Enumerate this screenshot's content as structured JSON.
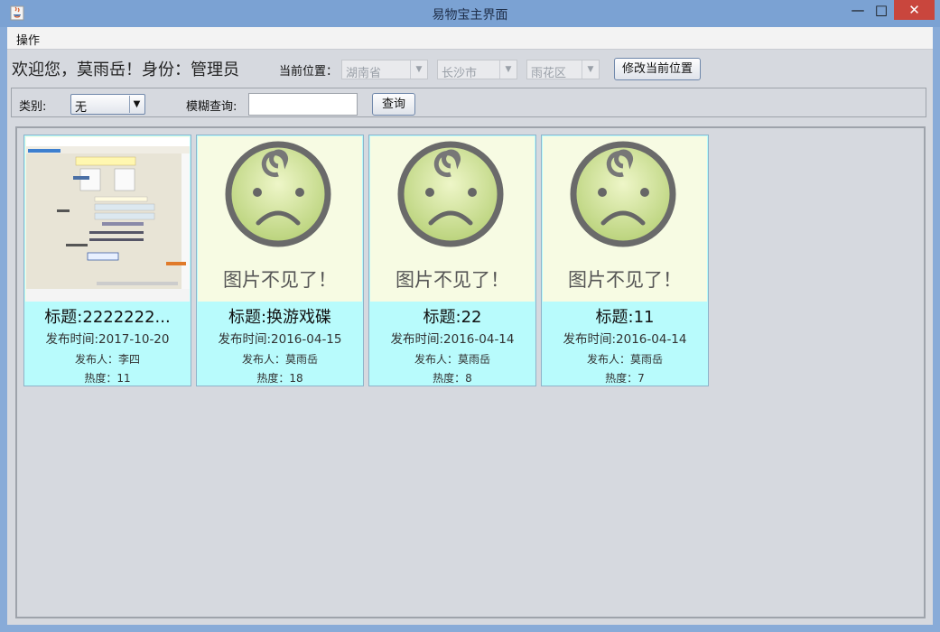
{
  "window": {
    "title": "易物宝主界面",
    "min": "—",
    "max": "□",
    "close": "✕"
  },
  "menu": {
    "items": [
      "操作"
    ]
  },
  "header": {
    "welcome": "欢迎您，莫雨岳！身份：管理员",
    "location_label": "当前位置：",
    "province": "湖南省",
    "city": "长沙市",
    "district": "雨花区",
    "modify_button": "修改当前位置"
  },
  "filter": {
    "category_label": "类别:",
    "category_value": "无",
    "search_label": "模糊查询:",
    "search_value": "",
    "search_button": "查询"
  },
  "items": [
    {
      "title": "标题:2222222...",
      "date": "发布时间:2017-10-20",
      "publisher": "发布人：李四",
      "heat": "热度：11",
      "image": "screenshot"
    },
    {
      "title": "标题:换游戏碟",
      "date": "发布时间:2016-04-15",
      "publisher": "发布人：莫雨岳",
      "heat": "热度：18",
      "image": "missing",
      "missing_text": "图片不见了！"
    },
    {
      "title": "标题:22",
      "date": "发布时间:2016-04-14",
      "publisher": "发布人：莫雨岳",
      "heat": "热度：8",
      "image": "missing",
      "missing_text": "图片不见了！"
    },
    {
      "title": "标题:11",
      "date": "发布时间:2016-04-14",
      "publisher": "发布人：莫雨岳",
      "heat": "热度：7",
      "image": "missing",
      "missing_text": "图片不见了！"
    }
  ],
  "colors": {
    "card_bg": "#b8fbfc",
    "image_bg": "#f7fbe3",
    "close": "#c9463d"
  }
}
